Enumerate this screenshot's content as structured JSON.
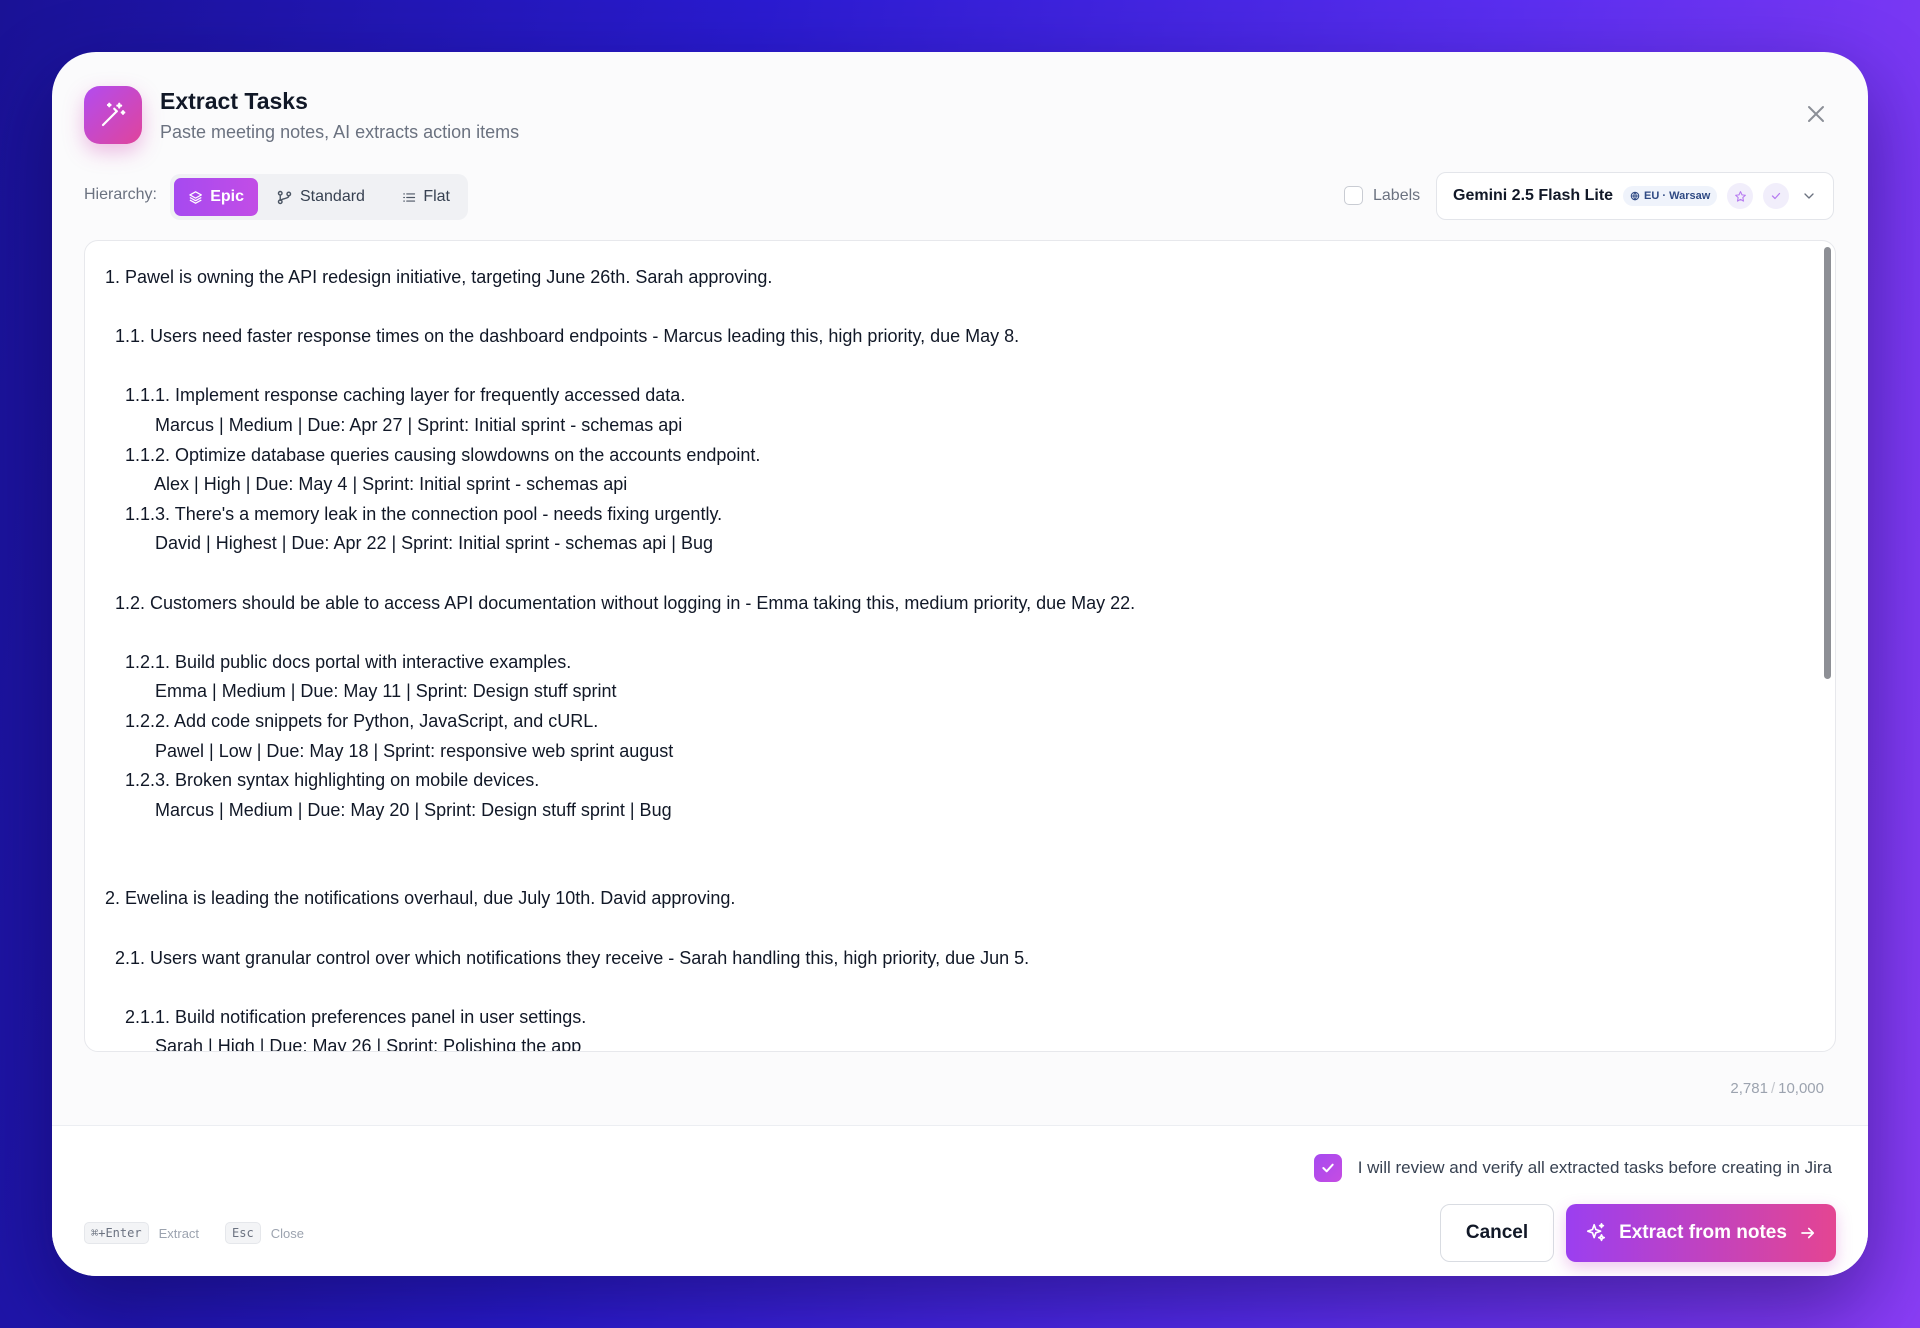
{
  "dialog": {
    "title": "Extract Tasks",
    "subtitle": "Paste meeting notes, AI extracts action items"
  },
  "toolbar": {
    "hierarchy_label": "Hierarchy:",
    "options": [
      {
        "label": "Epic",
        "active": true
      },
      {
        "label": "Standard",
        "active": false
      },
      {
        "label": "Flat",
        "active": false
      }
    ],
    "labels_toggle": {
      "label": "Labels",
      "checked": false
    },
    "model": {
      "name": "Gemini 2.5 Flash Lite",
      "region": "EU · Warsaw"
    }
  },
  "editor": {
    "text": "1. Pawel is owning the API redesign initiative, targeting June 26th. Sarah approving.\n\n  1.1. Users need faster response times on the dashboard endpoints - Marcus leading this, high priority, due May 8.\n\n    1.1.1. Implement response caching layer for frequently accessed data.\n          Marcus | Medium | Due: Apr 27 | Sprint: Initial sprint - schemas api\n    1.1.2. Optimize database queries causing slowdowns on the accounts endpoint.\n          Alex | High | Due: May 4 | Sprint: Initial sprint - schemas api\n    1.1.3. There's a memory leak in the connection pool - needs fixing urgently.\n          David | Highest | Due: Apr 22 | Sprint: Initial sprint - schemas api | Bug\n\n  1.2. Customers should be able to access API documentation without logging in - Emma taking this, medium priority, due May 22.\n\n    1.2.1. Build public docs portal with interactive examples.\n          Emma | Medium | Due: May 11 | Sprint: Design stuff sprint\n    1.2.2. Add code snippets for Python, JavaScript, and cURL.\n          Pawel | Low | Due: May 18 | Sprint: responsive web sprint august\n    1.2.3. Broken syntax highlighting on mobile devices.\n          Marcus | Medium | Due: May 20 | Sprint: Design stuff sprint | Bug\n\n\n2. Ewelina is leading the notifications overhaul, due July 10th. David approving.\n\n  2.1. Users want granular control over which notifications they receive - Sarah handling this, high priority, due Jun 5.\n\n    2.1.1. Build notification preferences panel in user settings.\n          Sarah | High | Due: May 26 | Sprint: Polishing the app",
    "char_count": "2,781",
    "char_limit": "10,000"
  },
  "footer": {
    "verify_text": "I will review and verify all extracted tasks before creating in Jira",
    "verify_checked": true,
    "shortcuts": [
      {
        "key": "⌘+Enter",
        "label": "Extract"
      },
      {
        "key": "Esc",
        "label": "Close"
      }
    ],
    "cancel_label": "Cancel",
    "extract_label": "Extract from notes"
  },
  "colors": {
    "accent_start": "#a64af0",
    "accent_end": "#e44592",
    "region_badge_text": "#2f4a84"
  },
  "icons": [
    "magic-wand-icon",
    "close-icon",
    "layers-icon",
    "git-branch-icon",
    "list-icon",
    "globe-icon",
    "star-icon",
    "check-icon",
    "chevron-down-icon",
    "sparkles-icon",
    "arrow-right-icon"
  ]
}
